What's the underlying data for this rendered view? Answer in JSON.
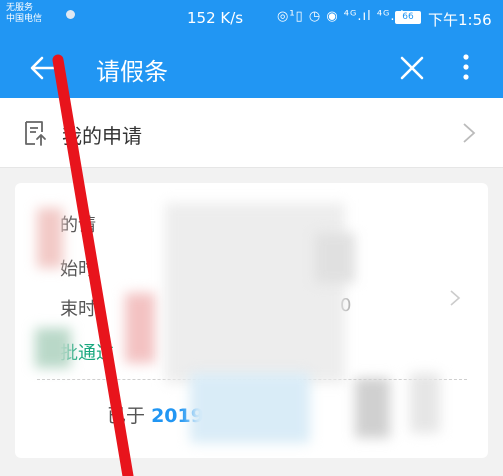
{
  "status_bar": {
    "carrier_line1": "无服务",
    "carrier_line2": "中国电信",
    "speed": "152 K/s",
    "icons_text": "◎¹▯ ◷ ◉ ⁴ᴳ.ıl ⁴ᴳ.ıl",
    "battery": "66",
    "time": "下午1:56"
  },
  "app_bar": {
    "title": "请假条"
  },
  "my_application": {
    "label": "我的申请"
  },
  "card": {
    "row1_label": "的请",
    "row2_label": "始时",
    "row3_label": "束时",
    "row3_partial_value": "0",
    "status_text": "批通过",
    "footer_prefix": "已于",
    "footer_year": "2019"
  },
  "colors": {
    "primary": "#2196f3",
    "status_green": "#1aa87f",
    "annotation_red": "#e8141c"
  }
}
